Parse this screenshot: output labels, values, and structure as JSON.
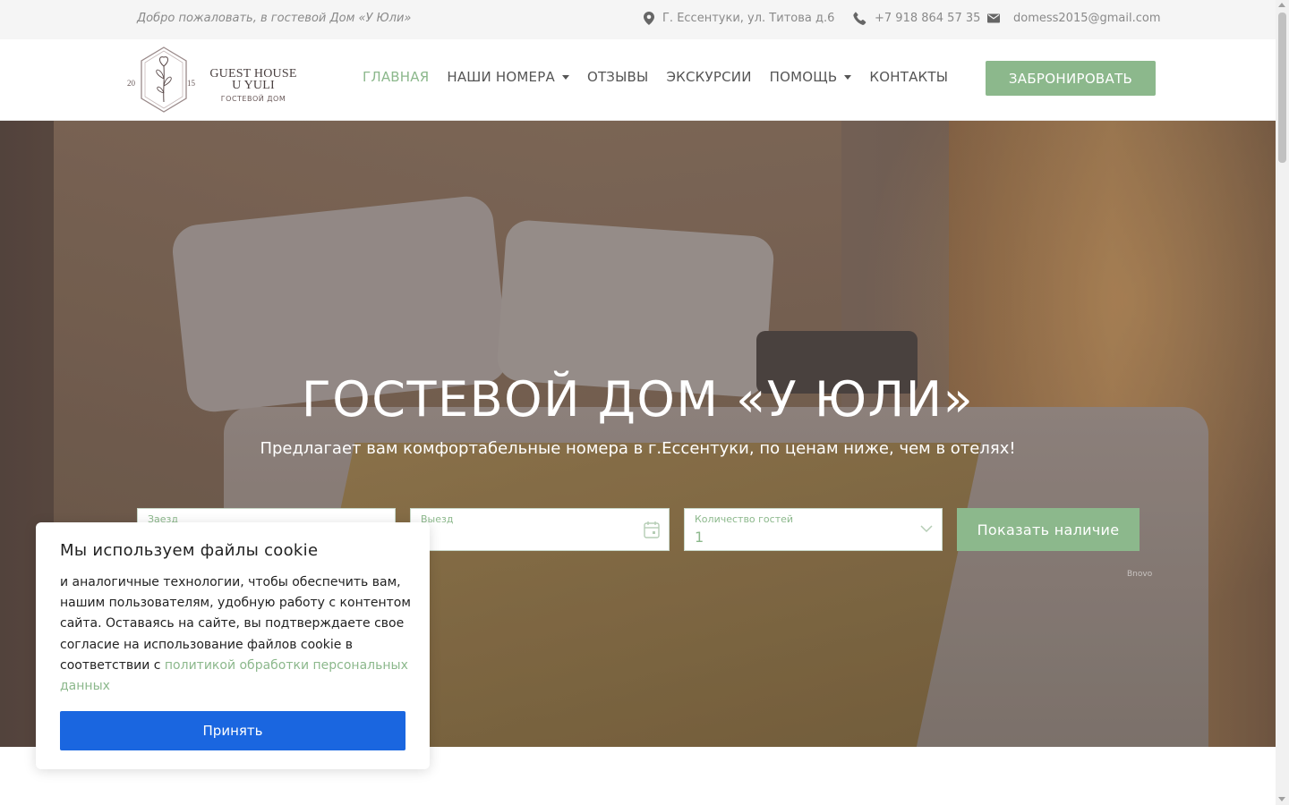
{
  "topbar": {
    "welcome": "Добро пожаловать, в гостевой Дом «У Юли»",
    "address": "Г. Ессентуки, ул. Титова д.6",
    "phone": "+7 918 864 57 35",
    "email": "domess2015@gmail.com",
    "address_icon": "map-pin-icon",
    "phone_icon": "phone-icon",
    "email_icon": "mail-icon"
  },
  "logo": {
    "title_line1": "GUEST HOUSE",
    "title_line2": "U YULI",
    "subtitle": "ГОСТЕВОЙ ДОМ",
    "year_left": "20",
    "year_right": "15"
  },
  "nav": {
    "items": [
      {
        "label": "ГЛАВНАЯ",
        "active": true,
        "dropdown": false
      },
      {
        "label": "НАШИ НОМЕРА",
        "active": false,
        "dropdown": true
      },
      {
        "label": "ОТЗЫВЫ",
        "active": false,
        "dropdown": false
      },
      {
        "label": "ЭКСКУРСИИ",
        "active": false,
        "dropdown": false
      },
      {
        "label": "ПОМОЩЬ",
        "active": false,
        "dropdown": true
      },
      {
        "label": "КОНТАКТЫ",
        "active": false,
        "dropdown": false
      }
    ],
    "book_label": "ЗАБРОНИРОВАТЬ"
  },
  "hero": {
    "title": "ГОСТЕВОЙ ДОМ «У ЮЛИ»",
    "lead": "Предлагает вам комфортабельные номера в г.Ессентуки, по ценам ниже, чем в отелях!"
  },
  "booking": {
    "checkin_label": "Заезд",
    "checkout_label": "Выезд",
    "guests_label": "Количество гостей",
    "guests_value": "1",
    "submit_label": "Показать наличие",
    "powered_by": "Bnovo",
    "calendar_icon": "calendar-icon",
    "chevron_icon": "chevron-down-icon"
  },
  "cookie": {
    "title": "Мы используем файлы cookie",
    "text": " и аналогичные технологии, чтобы обеспечить вам, нашим пользователям, удобную работу с контентом сайта. Оставаясь на сайте, вы подтверждаете свое согласие на использование файлов cookie в соответствии с ",
    "link": "политикой обработки персональных данных",
    "accept_label": "Принять"
  },
  "colors": {
    "accent_green": "#8cb88c",
    "accept_blue": "#1a66e0",
    "topbar_bg": "#f5f5f5"
  }
}
